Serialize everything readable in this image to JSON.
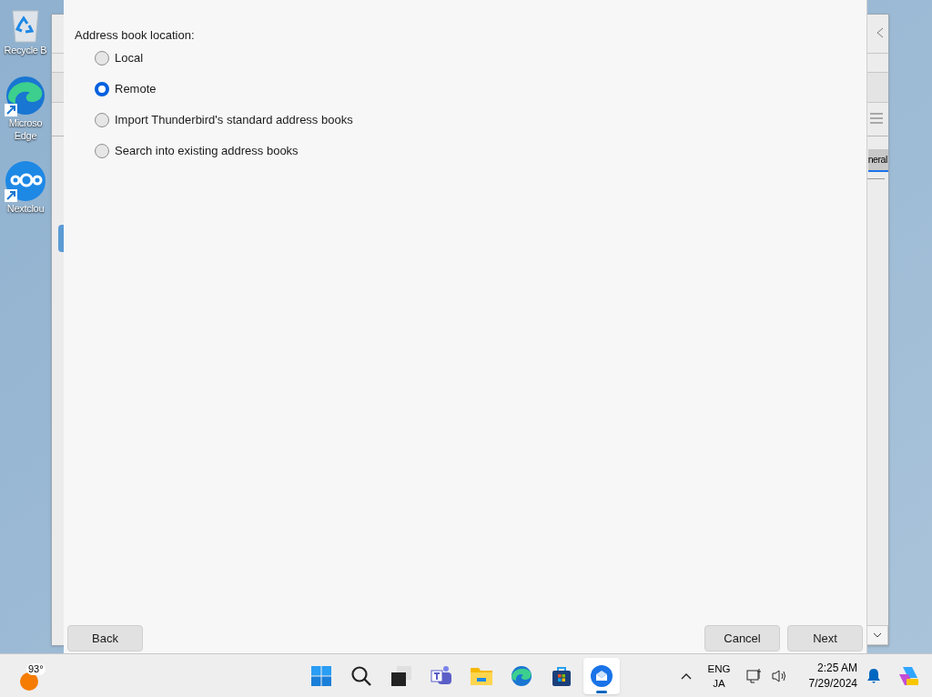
{
  "desktop_icons": [
    {
      "kind": "recycle",
      "lines": [
        "Recycle B"
      ]
    },
    {
      "kind": "edge",
      "lines": [
        "Microso",
        "Edge"
      ]
    },
    {
      "kind": "nextcloud",
      "lines": [
        "Nextclou"
      ]
    }
  ],
  "background_window": {
    "tab_label": "neral"
  },
  "dialog": {
    "heading": "Address book location:",
    "options": [
      {
        "label": "Local",
        "selected": false
      },
      {
        "label": "Remote",
        "selected": true
      },
      {
        "label": "Import Thunderbird's standard address books",
        "selected": false
      },
      {
        "label": "Search into existing address books",
        "selected": false
      }
    ],
    "buttons": {
      "back": "Back",
      "cancel": "Cancel",
      "next": "Next"
    }
  },
  "taskbar": {
    "weather": "93°",
    "apps": [
      {
        "kind": "start",
        "selected": false
      },
      {
        "kind": "search",
        "selected": false
      },
      {
        "kind": "taskview",
        "selected": false
      },
      {
        "kind": "teams",
        "selected": false
      },
      {
        "kind": "explorer",
        "selected": false
      },
      {
        "kind": "edge",
        "selected": false
      },
      {
        "kind": "store",
        "selected": false
      },
      {
        "kind": "thunderbird",
        "selected": true
      }
    ],
    "language": [
      "ENG",
      "JA"
    ],
    "time": "2:25 AM",
    "date": "7/29/2024"
  }
}
